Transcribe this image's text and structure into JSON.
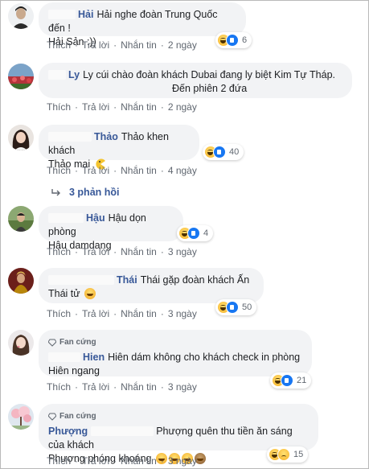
{
  "actions": {
    "like": "Thích",
    "reply": "Trả lời",
    "message": "Nhắn tin",
    "sep": "·"
  },
  "badge_label": "Fan cứng",
  "comments": [
    {
      "name": "Hải",
      "text": "Hải nghe đoàn Trung Quốc đến !",
      "text2": "Hải Sản :))",
      "time": "2 ngày",
      "reactions": "6"
    },
    {
      "name": "Ly",
      "text": "Ly cúi chào đoàn khách Dubai đang ly biệt Kim Tự Tháp.",
      "text2": "Đến phiên 2 đứa",
      "time": "2 ngày"
    },
    {
      "name": "Thảo",
      "text": "Thảo khen khách",
      "text2": "Thảo mai",
      "time": "4 ngày",
      "reactions": "40"
    },
    {
      "name": "Hậu",
      "text": "Hậu dọn phòng",
      "text2": "Hậu damdang",
      "time": "3 ngày",
      "reactions": "4"
    },
    {
      "name": "Thái",
      "text": "Thái gặp đoàn khách Ấn",
      "text2": "Thái tử",
      "time": "3 ngày",
      "reactions": "50"
    },
    {
      "name": "Hien",
      "text": "Hiên dám không cho khách check in phòng",
      "text2": "Hiên ngang",
      "time": "3 ngày",
      "reactions": "21"
    },
    {
      "name": "Phượng",
      "text": "Phượng quên thu tiền ăn sáng của khách",
      "text2": "Phượng phóng khoáng",
      "time": "3 ngày",
      "reactions": "15"
    }
  ],
  "replies_label": "3 phản hồi",
  "colors": {
    "link": "#385898",
    "bubble": "#f2f3f5",
    "meta": "#606770"
  }
}
